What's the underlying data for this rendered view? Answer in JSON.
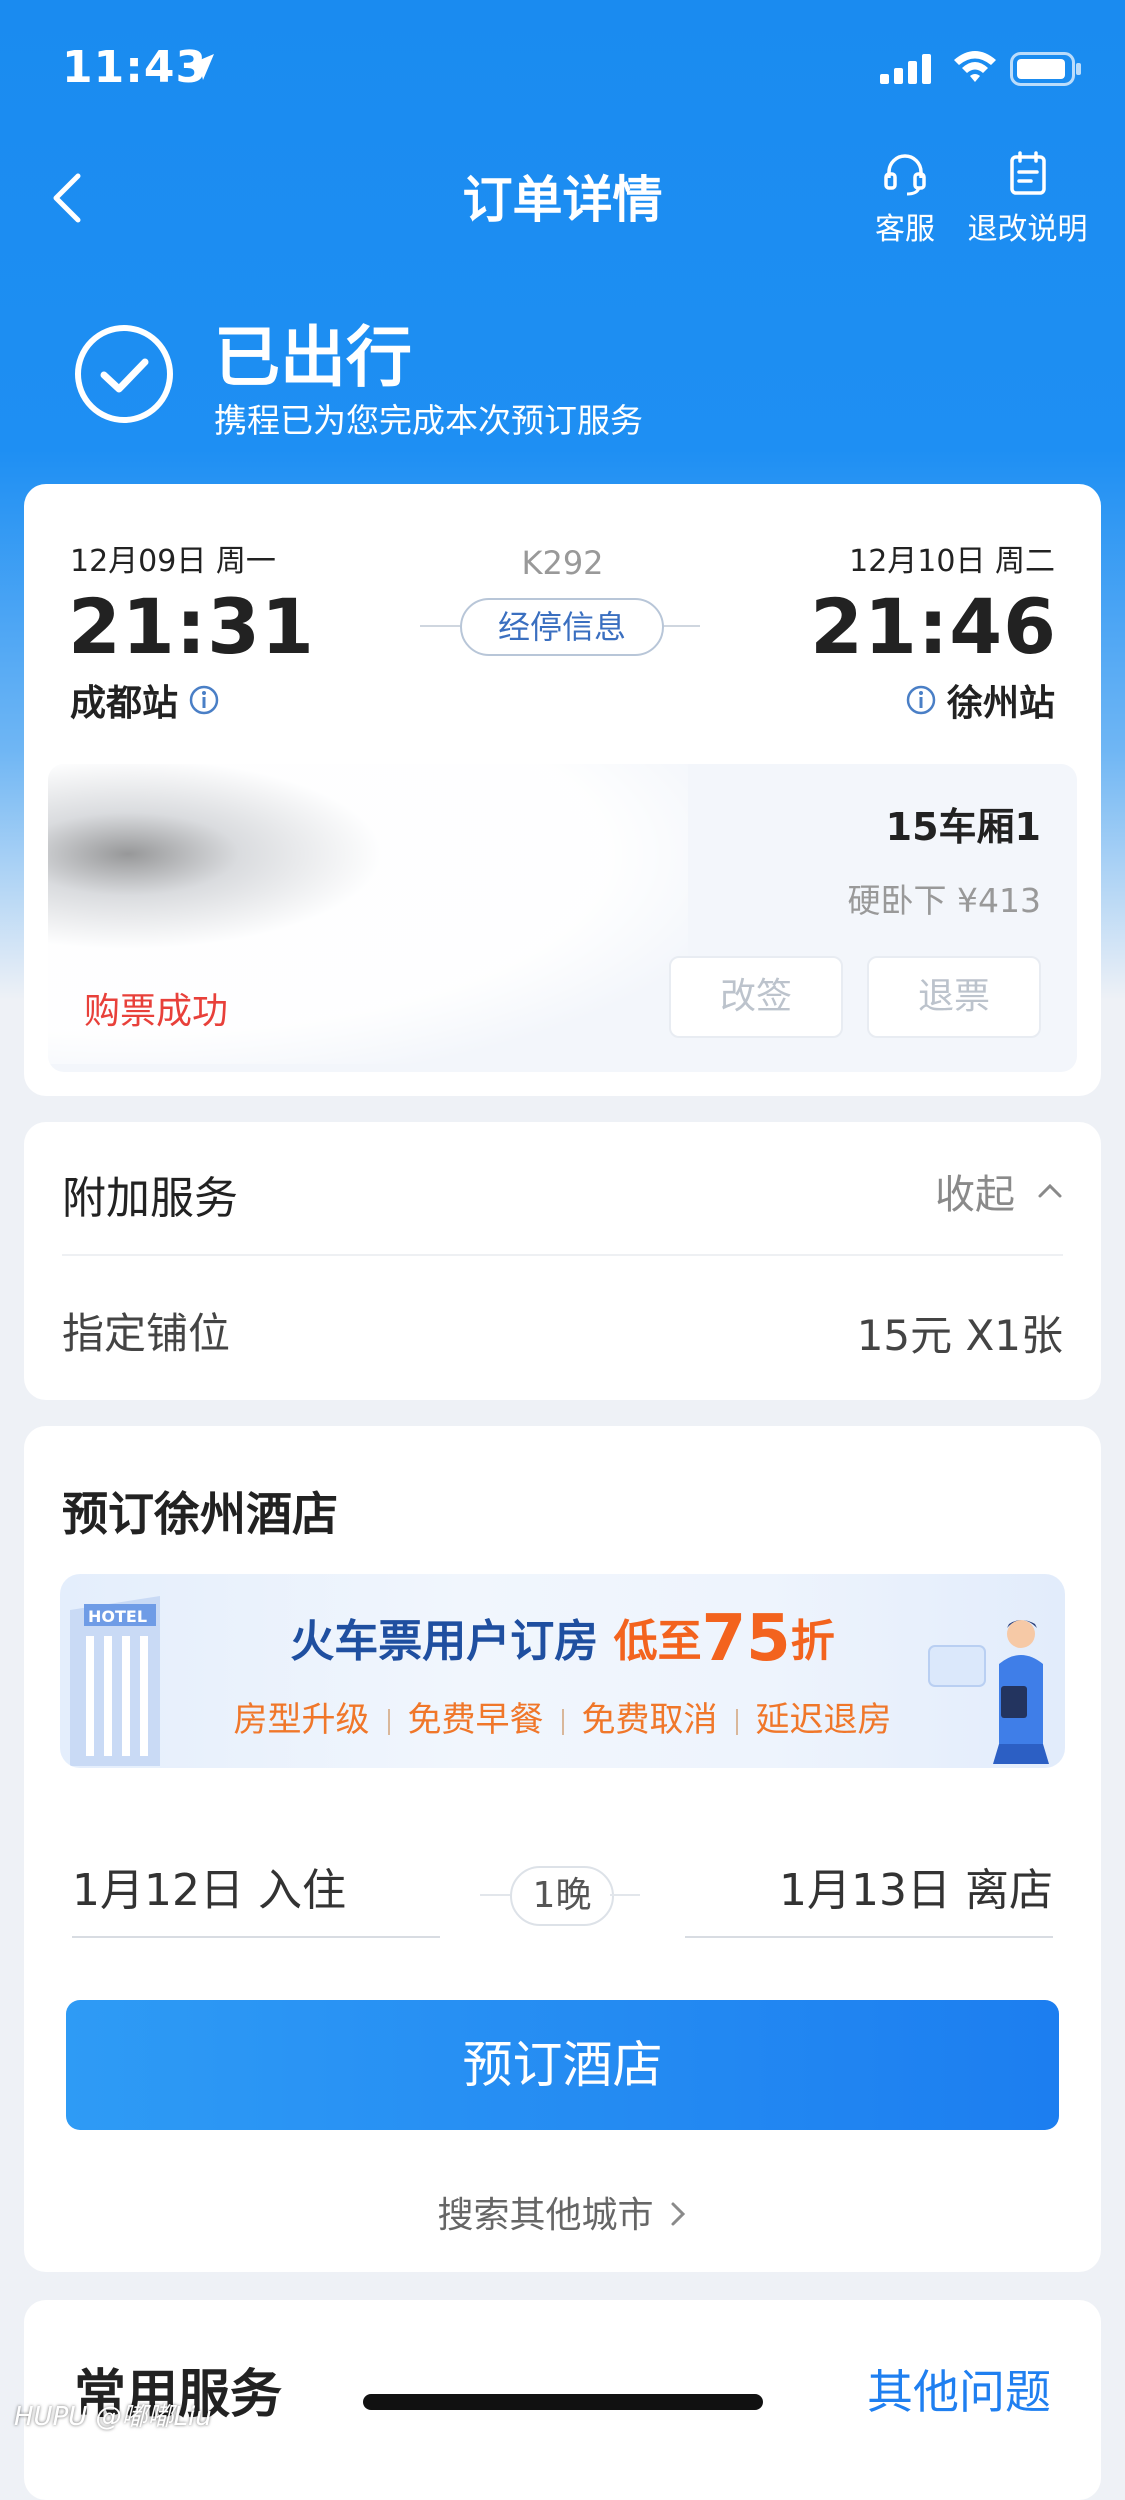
{
  "status_bar": {
    "time": "11:43"
  },
  "nav": {
    "title": "订单详情",
    "service_label": "客服",
    "policy_label": "退改说明"
  },
  "order_status": {
    "title": "已出行",
    "subtitle": "携程已为您完成本次预订服务"
  },
  "ticket": {
    "depart": {
      "date": "12月09日 周一",
      "time": "21:31",
      "station": "成都站"
    },
    "arrive": {
      "date": "12月10日 周二",
      "time": "21:46",
      "station": "徐州站"
    },
    "train_no": "K292",
    "stops_label": "经停信息",
    "car": "15车厢1",
    "seat_price": "硬卧下 ¥413",
    "status": "购票成功",
    "change_label": "改签",
    "refund_label": "退票"
  },
  "addon": {
    "title": "附加服务",
    "toggle": "收起",
    "item": "指定铺位",
    "value": "15元 X1张"
  },
  "hotel": {
    "title": "预订徐州酒店",
    "banner": {
      "logo_text": "HOTEL",
      "text_main": "火车票用户订房",
      "text_low": "低至",
      "discount": "75",
      "text_unit": "折",
      "tags": [
        "房型升级",
        "免费早餐",
        "免费取消",
        "延迟退房"
      ]
    },
    "checkin": "1月12日 入住",
    "checkout": "1月13日 离店",
    "nights": "1晚",
    "book_label": "预订酒店",
    "search_other": "搜索其他城市"
  },
  "common": {
    "title": "常用服务",
    "link": "其他问题"
  },
  "watermark": "HUPU @嘟嘟Liu",
  "colors": {
    "primary": "#1e8ff3",
    "success_red": "#e8403a",
    "promo_orange": "#f3631e",
    "link_blue": "#1f7ff0"
  }
}
